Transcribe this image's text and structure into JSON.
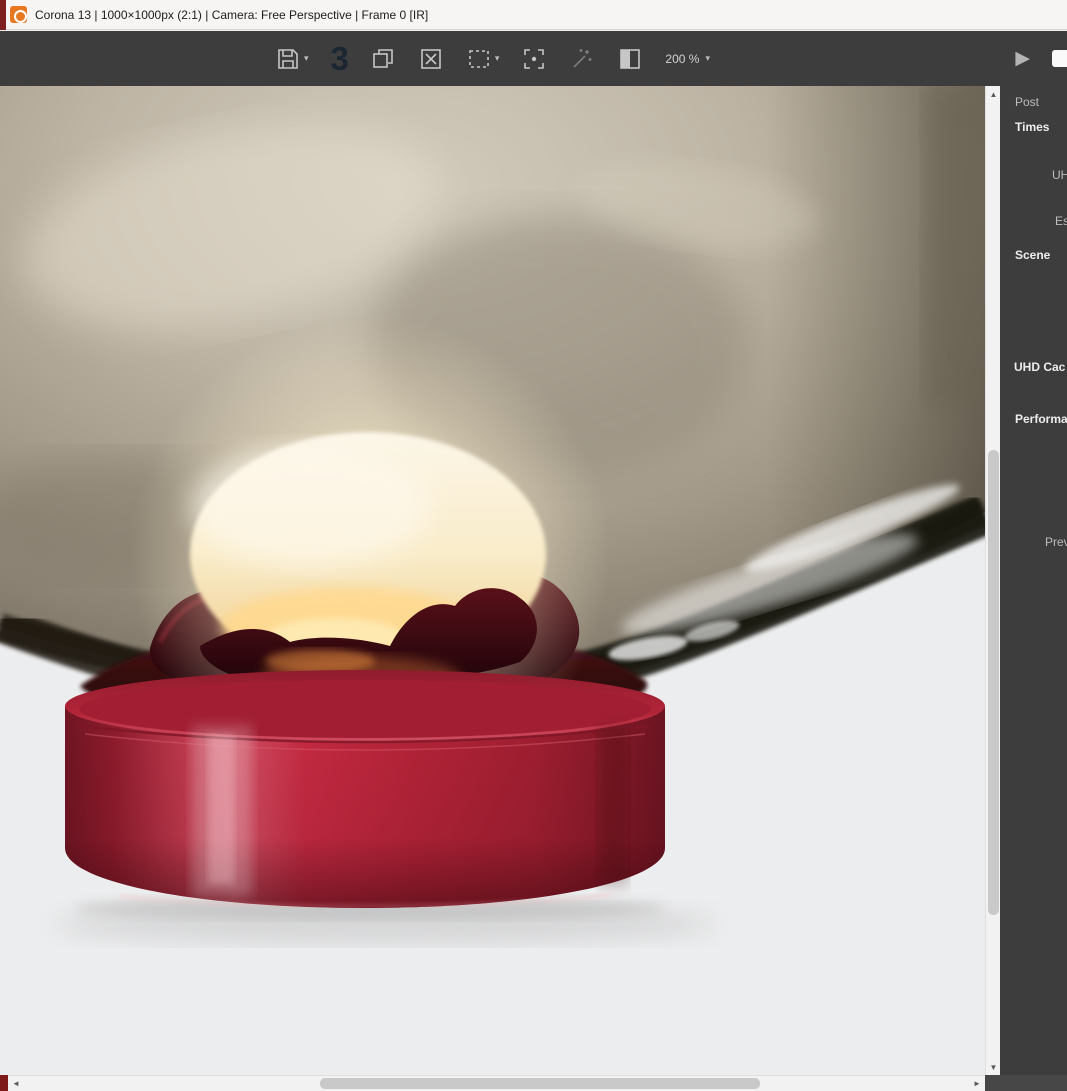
{
  "window": {
    "title": "Corona 13 | 1000×1000px (2:1) | Camera: Free Perspective | Frame 0 [IR]"
  },
  "toolbar": {
    "history_count": "3",
    "zoom_value": "200 %"
  },
  "icons": {
    "caret_down": "▾",
    "scroll_up": "▲",
    "scroll_down": "▼",
    "scroll_left": "◄",
    "scroll_right": "►",
    "play": "▶"
  },
  "right_panel": {
    "items": [
      {
        "label": "Post"
      },
      {
        "label": "Times"
      },
      {
        "label": "UH"
      },
      {
        "label": "Es"
      },
      {
        "label": "Scene"
      },
      {
        "label": "UHD Cac"
      },
      {
        "label": "Performa"
      },
      {
        "label": "Prev"
      }
    ]
  },
  "scene_colors": {
    "background": "#ecedee",
    "glass_smoke": "#a89f90",
    "bulb_glow": "#fdf2da",
    "base_red": "#b02336",
    "accent_orange": "#e87722",
    "toolbar_bg": "#3d3d3d"
  }
}
